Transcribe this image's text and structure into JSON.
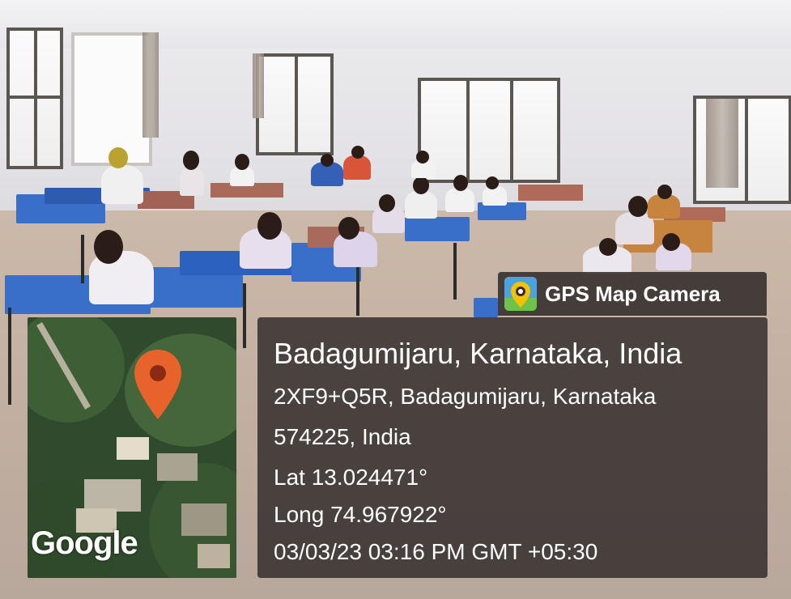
{
  "badge": {
    "app_name": "GPS Map Camera",
    "icon": "map-pin-icon"
  },
  "map": {
    "watermark": "Google",
    "pin_icon": "location-pin-icon",
    "pin_color": "#e8632c"
  },
  "location": {
    "title": "Badagumijaru, Karnataka, India",
    "address_line1": "2XF9+Q5R, Badagumijaru, Karnataka",
    "address_line2": "574225, India",
    "latitude": "Lat 13.024471°",
    "longitude": "Long 74.967922°",
    "timestamp": "03/03/23 03:16 PM GMT +05:30"
  }
}
